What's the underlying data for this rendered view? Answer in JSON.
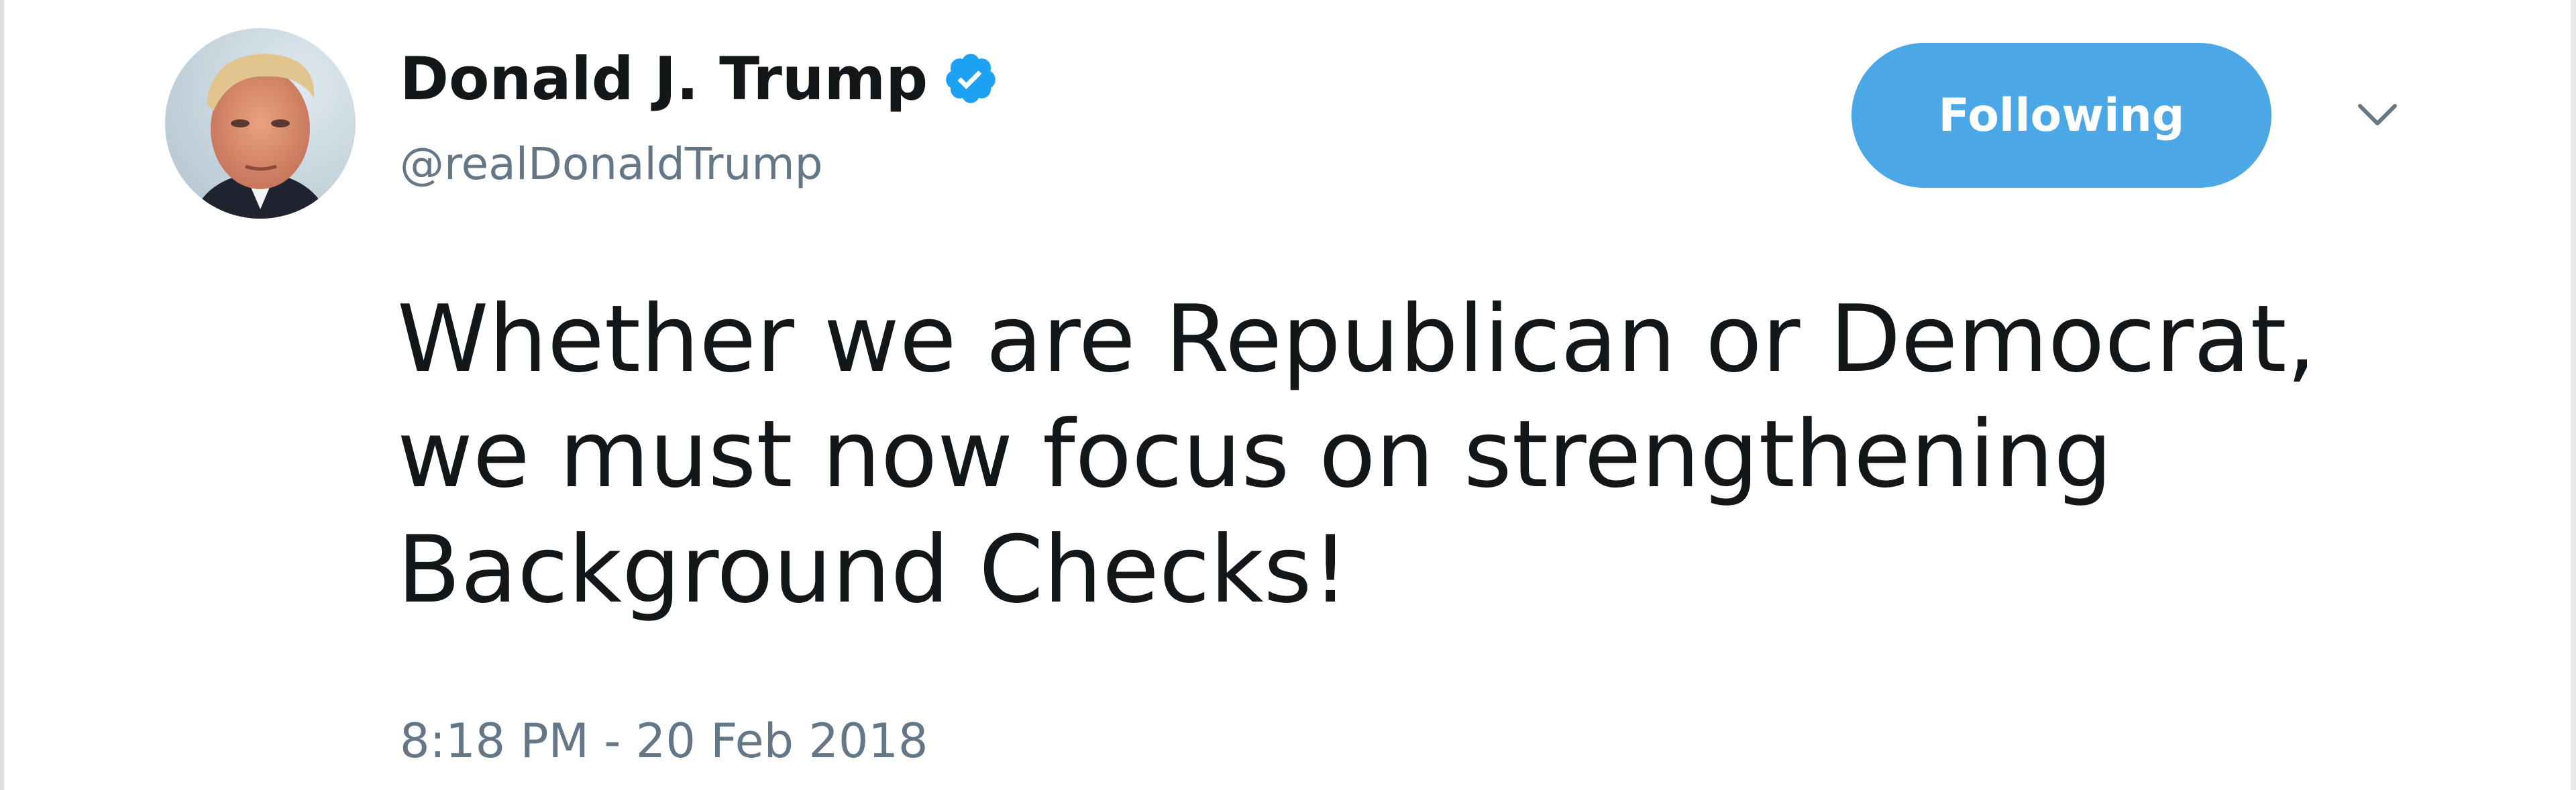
{
  "author": {
    "display_name": "Donald J. Trump",
    "handle": "@realDonaldTrump",
    "verified": true,
    "avatar_icon": "profile-photo"
  },
  "actions": {
    "follow_label": "Following",
    "menu_icon": "chevron-down-icon"
  },
  "tweet": {
    "lines": [
      "Whether we are Republican or Democrat,",
      "we must now focus on strengthening",
      "Background Checks!"
    ],
    "timestamp": "8:18 PM - 20 Feb 2018"
  },
  "colors": {
    "accent": "#4ba7e5",
    "verified_badge": "#1da1f2",
    "text_primary": "#14171a",
    "text_secondary": "#657786"
  }
}
